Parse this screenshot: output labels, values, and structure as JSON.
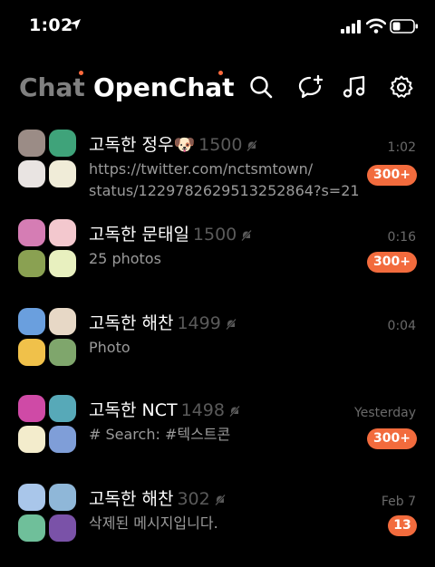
{
  "status": {
    "time": "1:02"
  },
  "header": {
    "tabs": [
      {
        "label": "Chat"
      },
      {
        "label": "OpenChat"
      }
    ]
  },
  "chats": [
    {
      "name": "고독한 정우🐶",
      "count": "1500",
      "time": "1:02",
      "preview_lines": [
        "https://twitter.com/nctsmtown/",
        "status/1229782629513252864?s=21"
      ],
      "badge": "300+",
      "avatar_colors": [
        "#9b8c86",
        "#3fa37a",
        "#e9e4e2",
        "#f0ecd8"
      ]
    },
    {
      "name": "고독한 문태일",
      "count": "1500",
      "time": "0:16",
      "preview_lines": [
        "25 photos"
      ],
      "badge": "300+",
      "avatar_colors": [
        "#d57db4",
        "#f3c8ce",
        "#8aa152",
        "#e8f0bf"
      ]
    },
    {
      "name": "고독한 해찬",
      "count": "1499",
      "time": "0:04",
      "preview_lines": [
        "Photo"
      ],
      "badge": "",
      "avatar_colors": [
        "#6a9fde",
        "#e7d8c6",
        "#f0c14a",
        "#7fa66c"
      ]
    },
    {
      "name": "고독한 NCT",
      "count": "1498",
      "time": "Yesterday",
      "preview_lines": [
        "# Search: #텍스트콘"
      ],
      "badge": "300+",
      "avatar_colors": [
        "#cf4aa6",
        "#57a9b8",
        "#f3eccc",
        "#7f9ed8"
      ]
    },
    {
      "name": "고독한 해찬",
      "count": "302",
      "time": "Feb 7",
      "preview_lines": [
        "삭제된 메시지입니다."
      ],
      "badge": "13",
      "avatar_colors": [
        "#a9c6ea",
        "#8fb7d8",
        "#6fbf9a",
        "#7a52a8"
      ]
    }
  ],
  "colors": {
    "accent": "#f26b3d",
    "background": "#000000"
  }
}
